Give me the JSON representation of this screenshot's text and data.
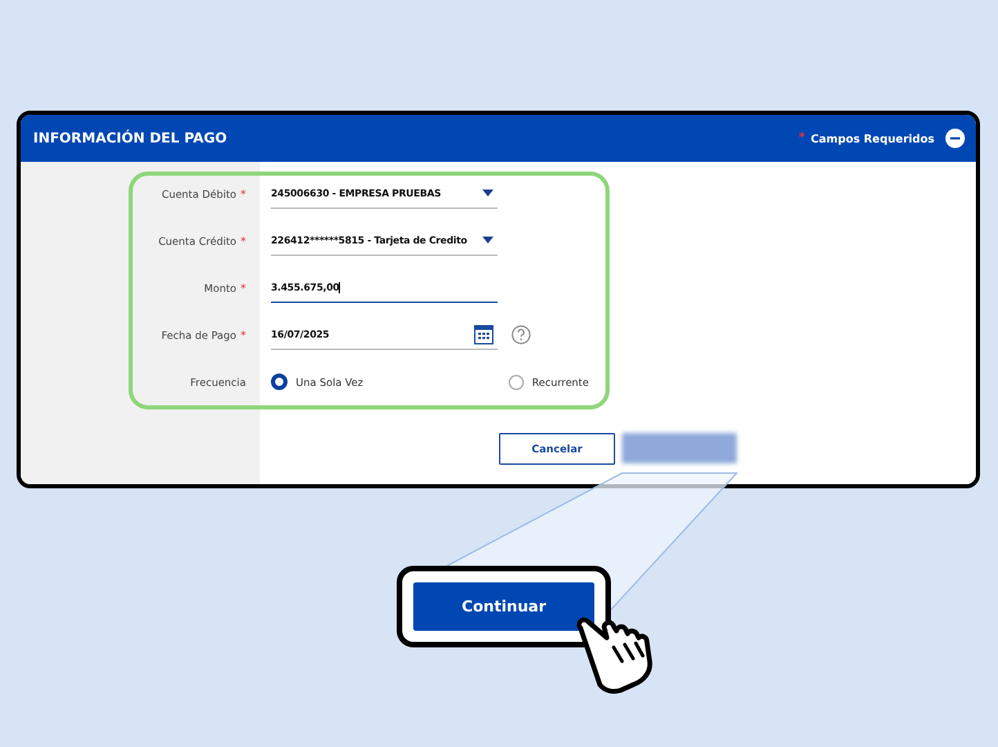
{
  "panel": {
    "title": "INFORMACIÓN DEL PAGO",
    "required_mark": "*",
    "required_note": "Campos Requeridos"
  },
  "fields": [
    {
      "kind": "select",
      "label": "Cuenta Débito",
      "required": true,
      "focused": false,
      "value": "245006630 - EMPRESA PRUEBAS"
    },
    {
      "kind": "select",
      "label": "Cuenta Crédito",
      "required": true,
      "focused": false,
      "value": "226412******5815 - Tarjeta de Credito"
    },
    {
      "kind": "input",
      "label": "Monto",
      "required": true,
      "focused": true,
      "value": "3.455.675,00"
    },
    {
      "kind": "date",
      "label": "Fecha de Pago",
      "required": true,
      "focused": false,
      "value": "16/07/2025"
    }
  ],
  "frequency": {
    "label": "Frecuencia",
    "options": [
      {
        "label": "Una Sola Vez",
        "selected": true
      },
      {
        "label": "Recurrente",
        "selected": false
      }
    ]
  },
  "buttons": {
    "cancel": "Cancelar"
  },
  "callout": {
    "label": "Continuar"
  }
}
